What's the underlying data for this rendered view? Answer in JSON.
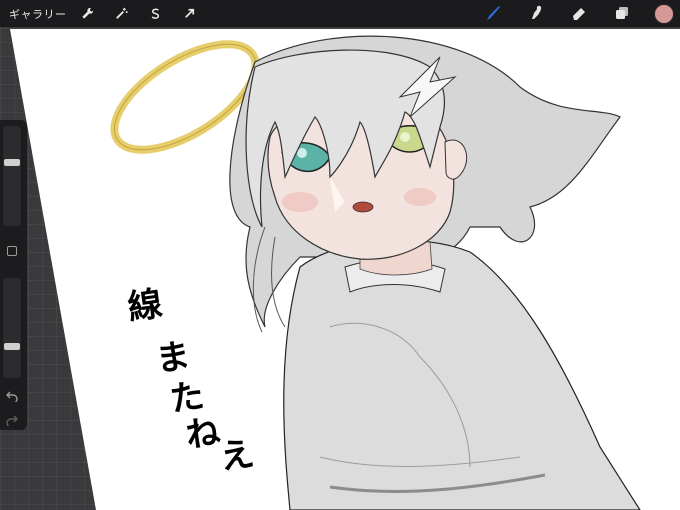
{
  "topbar": {
    "gallery_label": "ギャラリー",
    "left_tools": [
      "wrench-icon",
      "magic-wand-icon",
      "selection-icon",
      "transform-arrow-icon"
    ],
    "right_tools": [
      "brush-icon",
      "smudge-icon",
      "eraser-icon",
      "layers-icon"
    ],
    "active_tool": "brush-icon",
    "active_color": "#d69a96",
    "active_tool_color": "#2f6fe0"
  },
  "sidebar": {
    "brush_size_level": 0.35,
    "opacity_level": 0.7,
    "items": [
      "brush-size-slider",
      "modify-button",
      "opacity-slider",
      "undo-button",
      "redo-button"
    ]
  },
  "canvas": {
    "handwriting": [
      "線",
      "ま",
      "た",
      "ね",
      "え"
    ]
  }
}
